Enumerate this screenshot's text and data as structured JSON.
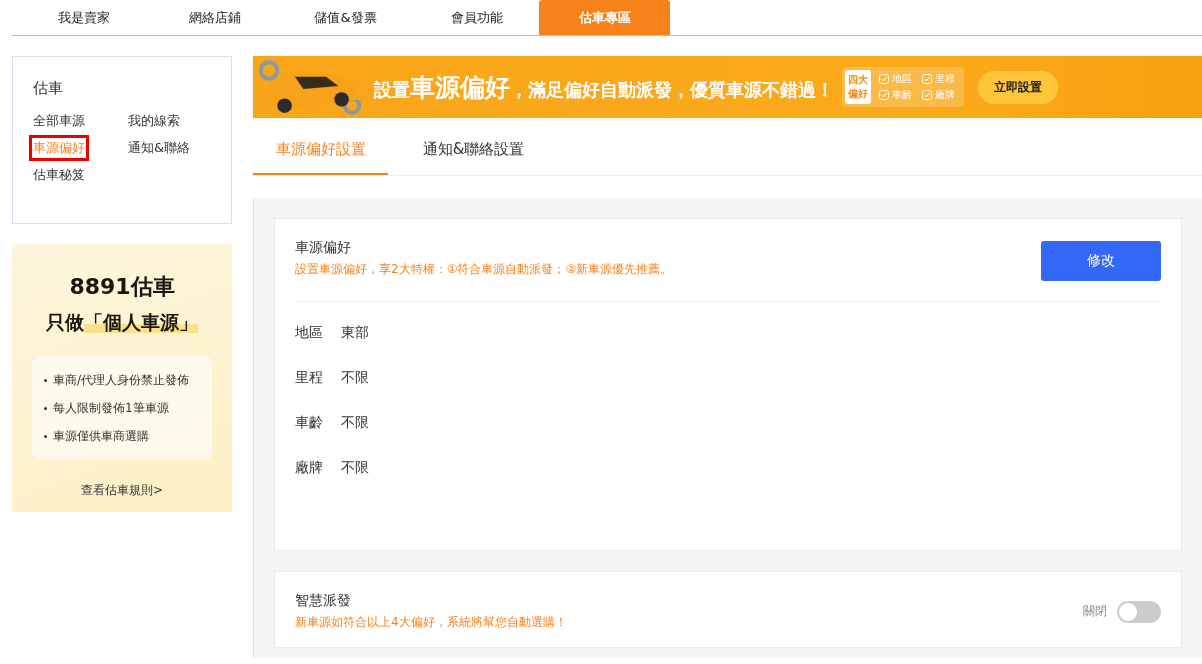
{
  "nav": [
    {
      "label": "我是賣家",
      "selected": false
    },
    {
      "label": "網絡店鋪",
      "selected": false
    },
    {
      "label": "儲值&發票",
      "selected": false
    },
    {
      "label": "會員功能",
      "selected": false
    },
    {
      "label": "估車專區",
      "selected": true
    }
  ],
  "sidebar": {
    "title": "估車",
    "items": [
      {
        "label": "全部車源",
        "selected": false
      },
      {
        "label": "我的線索",
        "selected": false
      },
      {
        "label": "車源偏好",
        "selected": true
      },
      {
        "label": "通知&聯絡",
        "selected": false
      },
      {
        "label": "估車秘笈",
        "selected": false
      }
    ]
  },
  "promo": {
    "logo": "8891估車",
    "headline_prefix": "只做",
    "headline_quote": "「個人車源」",
    "points": [
      "車商/代理人身份禁止發佈",
      "每人限制發佈1筆車源",
      "車源僅供車商選購"
    ],
    "link": "查看估車規則>"
  },
  "banner": {
    "prefix": "設置",
    "highlight": "車源偏好",
    "rest": "，滿足偏好自動派發，優質車源不錯過！",
    "badge": [
      "四大",
      "偏好"
    ],
    "checks": [
      "地區",
      "里程",
      "車齡",
      "廠牌"
    ],
    "button": "立即設置"
  },
  "tabs": [
    {
      "label": "車源偏好設置",
      "selected": true
    },
    {
      "label": "通知&聯絡設置",
      "selected": false
    }
  ],
  "preference_card": {
    "title": "車源偏好",
    "subtitle": "設置車源偏好，享2大特權：①符合車源自動派發；②新車源優先推薦。",
    "button": "修改",
    "fields": [
      {
        "label": "地區",
        "value": "東部"
      },
      {
        "label": "里程",
        "value": "不限"
      },
      {
        "label": "車齡",
        "value": "不限"
      },
      {
        "label": "廠牌",
        "value": "不限"
      }
    ]
  },
  "dispatch_card": {
    "title": "智慧派發",
    "subtitle": "新車源如符合以上4大偏好，系統將幫您自動選購！",
    "status": "關閉",
    "on": false
  }
}
